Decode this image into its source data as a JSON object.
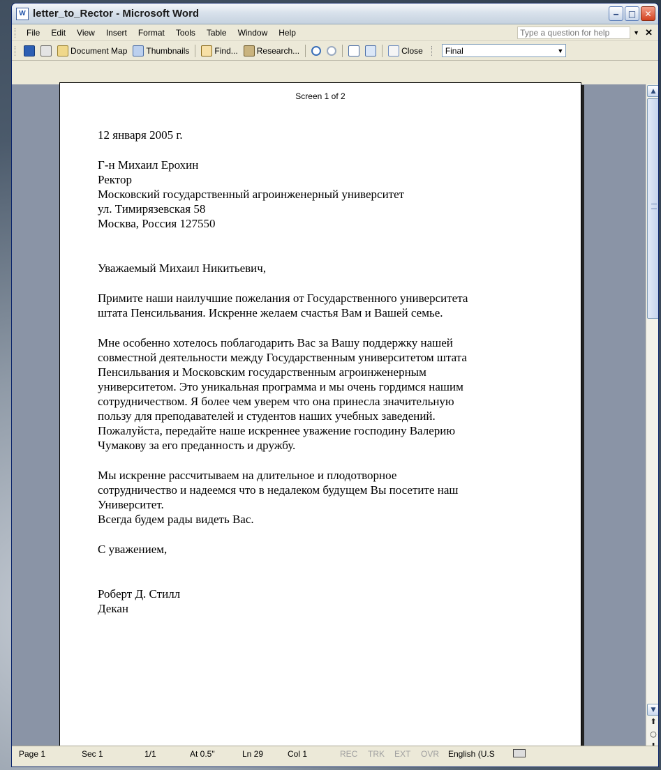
{
  "window": {
    "title": "letter_to_Rector - Microsoft Word",
    "app_icon": "W"
  },
  "menu": {
    "items": [
      {
        "label": "File"
      },
      {
        "label": "Edit"
      },
      {
        "label": "View"
      },
      {
        "label": "Insert"
      },
      {
        "label": "Format"
      },
      {
        "label": "Tools"
      },
      {
        "label": "Table"
      },
      {
        "label": "Window"
      },
      {
        "label": "Help"
      }
    ],
    "help_placeholder": "Type a question for help"
  },
  "toolbar": {
    "document_map": "Document Map",
    "thumbnails": "Thumbnails",
    "find": "Find...",
    "research": "Research...",
    "close": "Close",
    "view_mode": "Final"
  },
  "page": {
    "screen_label": "Screen 1 of 2"
  },
  "letter": {
    "date": "12 января 2005 г.",
    "recipient": [
      "Г-н Михаил Ерохин",
      "Ректор",
      "Московский государственный агроинженерный университет",
      "ул. Тимирязевская 58",
      "Москва, Россия 127550"
    ],
    "salutation": "Уважаемый Михаил Никитьевич,",
    "paragraph1": [
      "Примите наши наилучшие пожелания от Государственного университета",
      "штата Пенсильвания. Искренне желаем счастья Вам и Вашей семье."
    ],
    "paragraph2": [
      "Мне особенно хотелось поблагодарить Вас за Вашу поддержку нашей",
      "совместной деятельности между Государственным университетом штата",
      "Пенсильвания и Московским государственным агроинженерным",
      "университетом. Это уникальная программа и мы очень гордимся нашим",
      "сотрудничеством. Я более чем уверем что она принесла значительную",
      "пользу для преподавателей и студентов наших учебных заведений.",
      "Пожалуйста, передайте наше искреннее уважение господину Валерию",
      "Чумакову за его преданность и дружбу."
    ],
    "paragraph3": [
      "Мы искренне рассчитываем на длительное и плодотворное",
      "сотрудничество и надеемся что в недалеком будущем Вы посетите наш",
      "Университет.",
      "Всегда будем рады видеть Вас."
    ],
    "closing": "С уважением,",
    "signature": [
      "Роберт Д. Стилл",
      "Декан"
    ]
  },
  "status": {
    "page": "Page 1",
    "sec": "Sec 1",
    "pages": "1/1",
    "at": "At 0.5\"",
    "ln": "Ln 29",
    "col": "Col 1",
    "rec": "REC",
    "trk": "TRK",
    "ext": "EXT",
    "ovr": "OVR",
    "language": "English (U.S"
  }
}
